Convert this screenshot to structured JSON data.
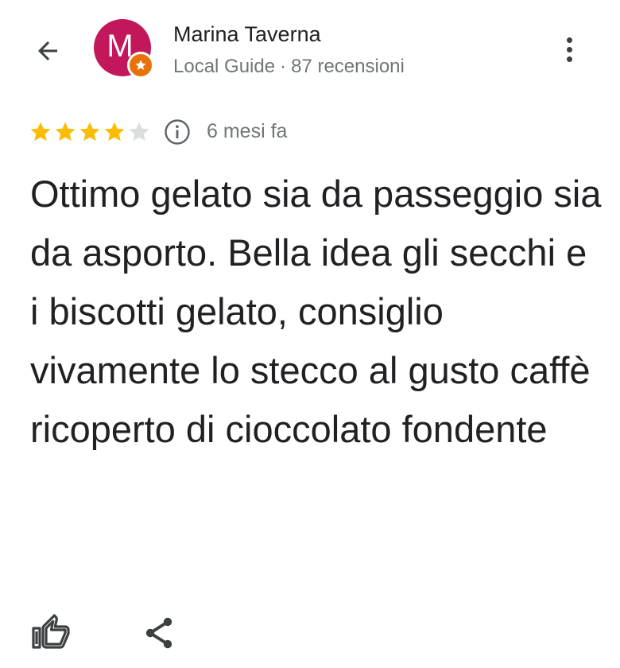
{
  "header": {
    "back_icon": "arrow-left-icon",
    "avatar_letter": "M",
    "avatar_color": "#c2185b",
    "badge_color": "#e8710a",
    "reviewer_name": "Marina Taverna",
    "guide_label": "Local Guide",
    "separator": "·",
    "review_count": "87 recensioni",
    "menu_icon": "more-vertical-icon"
  },
  "review": {
    "rating": 4,
    "max_rating": 5,
    "star_color": "#fbbc04",
    "time_ago": "6 mesi fa",
    "text": "Ottimo gelato sia da passeggio sia da asporto. Bella idea gli secchi e i biscotti gelato, consiglio vivamente lo stecco al gusto caffè ricoperto di cioccolato fondente"
  },
  "actions": {
    "like_icon": "thumbs-up-icon",
    "share_icon": "share-icon"
  }
}
